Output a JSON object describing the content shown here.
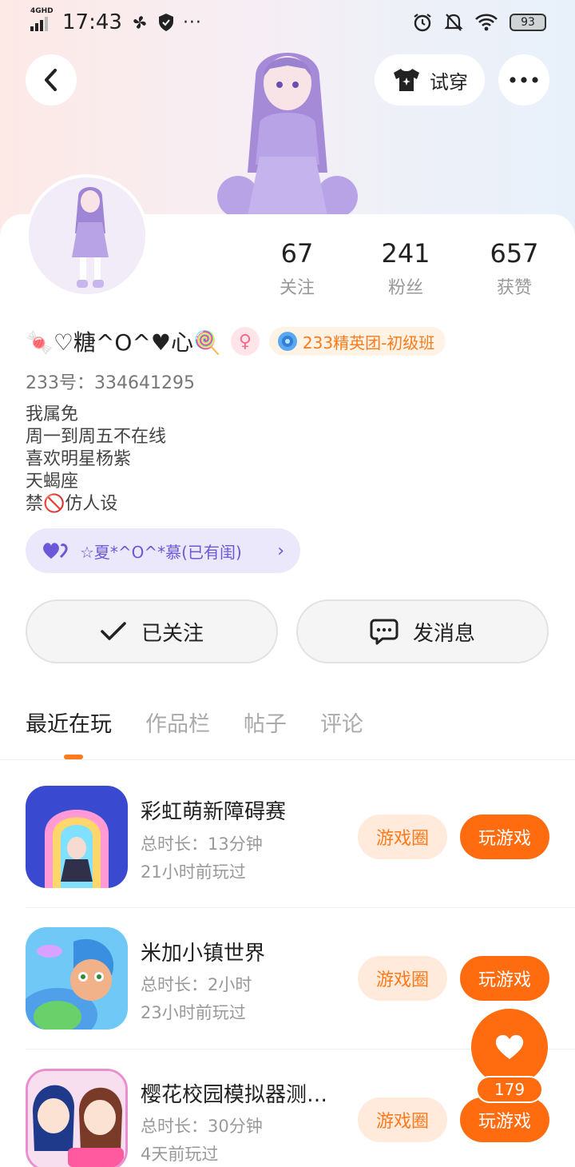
{
  "status_bar": {
    "network": "4GHD",
    "time": "17:43",
    "battery": "93"
  },
  "header": {
    "try_on_label": "试穿"
  },
  "profile": {
    "stats": [
      {
        "value": "67",
        "label": "关注"
      },
      {
        "value": "241",
        "label": "粉丝"
      },
      {
        "value": "657",
        "label": "获赞"
      }
    ],
    "nickname": "🍬♡糖^O^♥心🍭",
    "gender_symbol": "♀",
    "rank_badge": "233精英团-初级班",
    "uid": "233号：334641295",
    "bio": [
      "我属免",
      "周一到周五不在线",
      "喜欢明星杨紫",
      "天蝎座",
      "禁🚫仿人设"
    ],
    "cp_label": "☆夏*^O^*慕(已有闺)"
  },
  "actions": {
    "followed_label": "已关注",
    "message_label": "发消息"
  },
  "tabs": [
    "最近在玩",
    "作品栏",
    "帖子",
    "评论"
  ],
  "games": [
    {
      "title": "彩虹萌新障碍赛",
      "duration": "总时长：13分钟",
      "last_played": "21小时前玩过"
    },
    {
      "title": "米加小镇世界",
      "duration": "总时长：2小时",
      "last_played": "23小时前玩过"
    },
    {
      "title": "樱花校园模拟器测…",
      "duration": "总时长：30分钟",
      "last_played": "4天前玩过"
    }
  ],
  "game_buttons": {
    "circle": "游戏圈",
    "play": "玩游戏"
  },
  "like": {
    "count": "179"
  },
  "colors": {
    "accent": "#ff6c10",
    "accent_light": "#ffeadc",
    "cp_purple": "#6b58d8"
  }
}
